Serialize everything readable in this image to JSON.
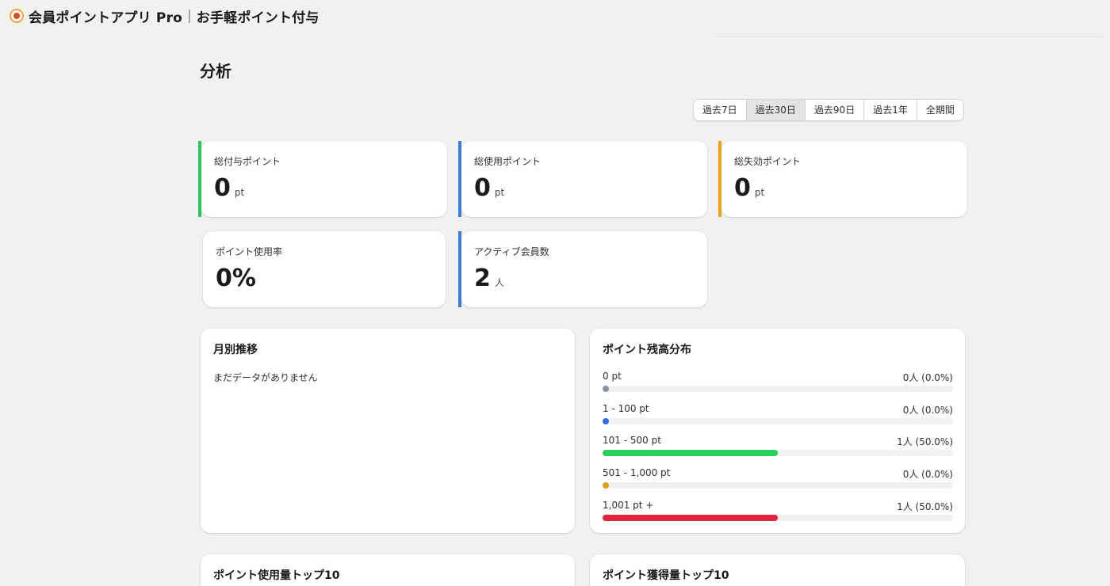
{
  "header": {
    "app_name": "会員ポイントアプリ Pro",
    "separator": "|",
    "page_name": "お手軽ポイント付与"
  },
  "page": {
    "title": "分析"
  },
  "period_tabs": [
    {
      "label": "過去7日",
      "active": false
    },
    {
      "label": "過去30日",
      "active": true
    },
    {
      "label": "過去90日",
      "active": false
    },
    {
      "label": "過去1年",
      "active": false
    },
    {
      "label": "全期間",
      "active": false
    }
  ],
  "stats": [
    {
      "label": "総付与ポイント",
      "value": "0",
      "unit": "pt",
      "accent": "#29c65b"
    },
    {
      "label": "総使用ポイント",
      "value": "0",
      "unit": "pt",
      "accent": "#3d7dd6"
    },
    {
      "label": "総失効ポイント",
      "value": "0",
      "unit": "pt",
      "accent": "#e8a317"
    },
    {
      "label": "ポイント使用率",
      "value": "0%",
      "unit": "",
      "accent": ""
    },
    {
      "label": "アクティブ会員数",
      "value": "2",
      "unit": "人",
      "accent": "#3d7dd6"
    }
  ],
  "monthly": {
    "title": "月別推移",
    "empty_message": "まだデータがありません"
  },
  "distribution": {
    "title": "ポイント残高分布",
    "rows": [
      {
        "label": "0 pt",
        "count": "0人 (0.0%)",
        "fraction": 0.0,
        "color": "#8a93a6"
      },
      {
        "label": "1 - 100 pt",
        "count": "0人 (0.0%)",
        "fraction": 0.0,
        "color": "#2f6fdd"
      },
      {
        "label": "101 - 500 pt",
        "count": "1人 (50.0%)",
        "fraction": 0.5,
        "color": "#29d05a"
      },
      {
        "label": "501 - 1,000 pt",
        "count": "0人 (0.0%)",
        "fraction": 0.0,
        "color": "#e0a015"
      },
      {
        "label": "1,001 pt +",
        "count": "1人 (50.0%)",
        "fraction": 0.5,
        "color": "#e0243e"
      }
    ]
  },
  "top_usage": {
    "title": "ポイント使用量トップ10"
  },
  "top_earned": {
    "title": "ポイント獲得量トップ10"
  }
}
